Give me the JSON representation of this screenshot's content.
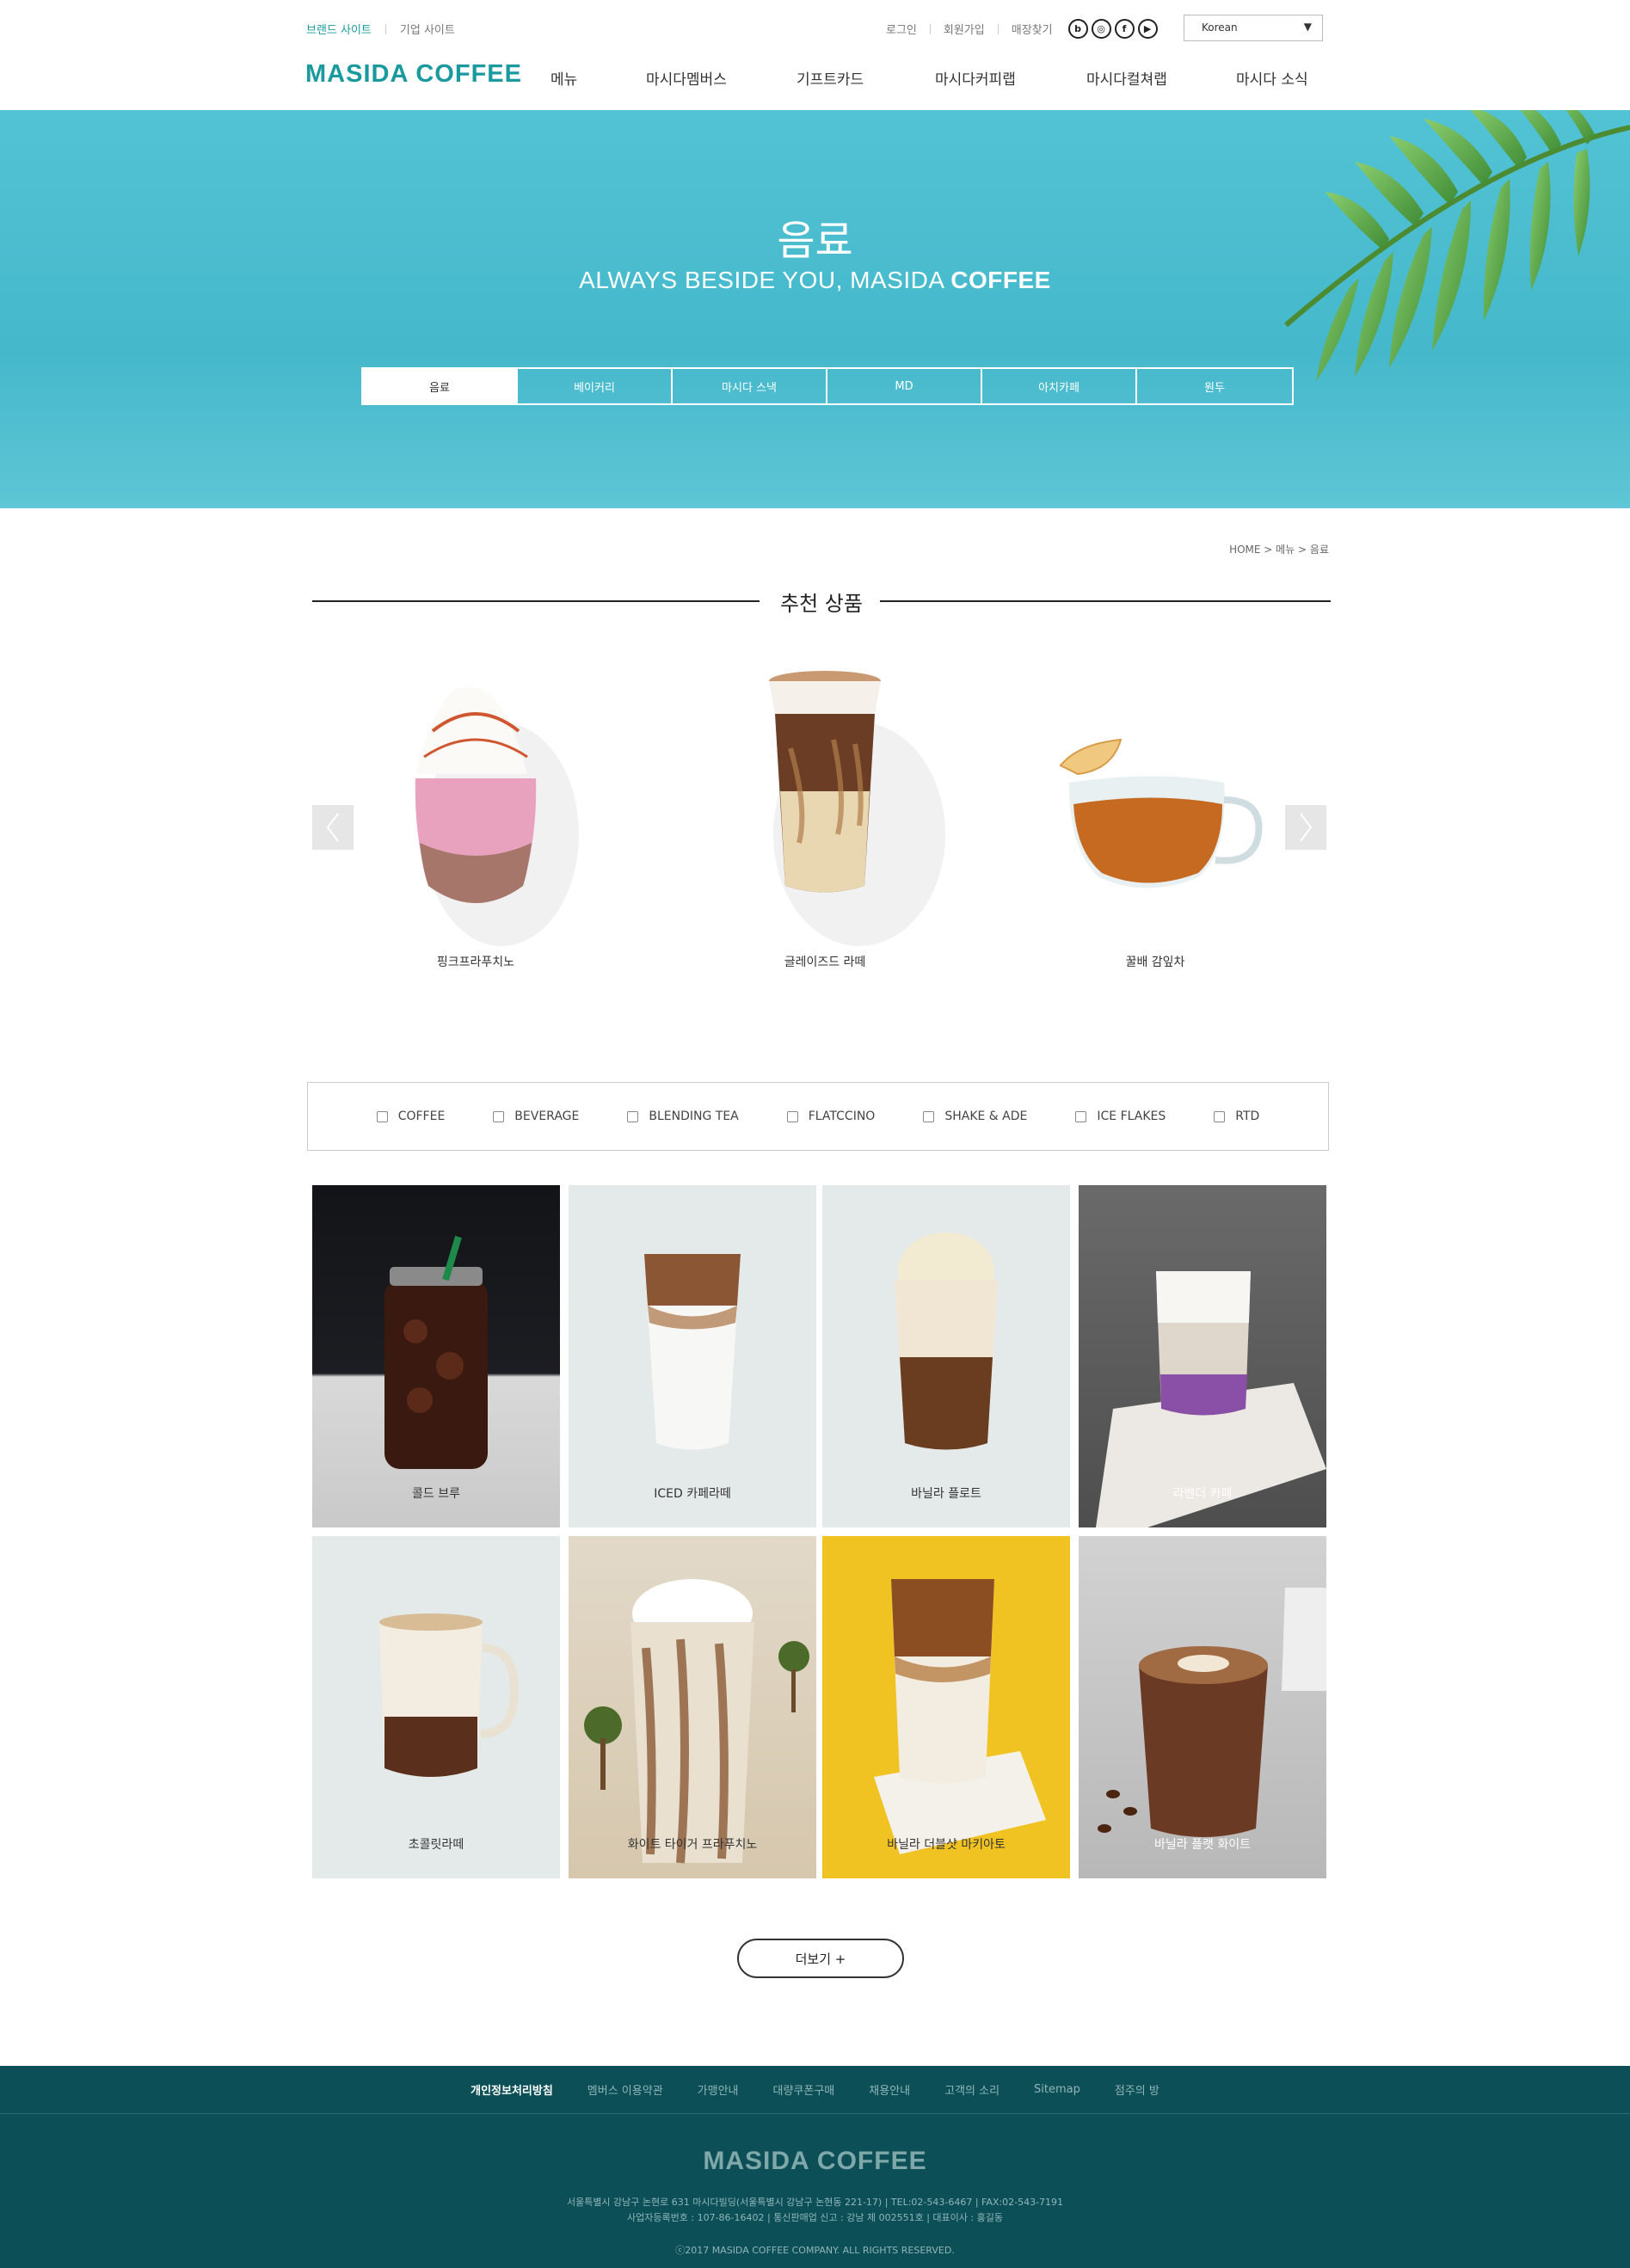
{
  "util": {
    "brand_site": "브랜드 사이트",
    "corp_site": "기업 사이트",
    "login": "로그인",
    "join": "회원가입",
    "store": "매장찾기",
    "language": "Korean"
  },
  "logo": "MASIDA COFFEE",
  "gnb": [
    "메뉴",
    "마시다멤버스",
    "기프트카드",
    "마시다커피랩",
    "마시다컬쳐랩",
    "마시다 소식"
  ],
  "hero": {
    "title": "음료",
    "sub_plain": "ALWAYS BESIDE YOU, MASIDA ",
    "sub_bold": "COFFEE",
    "tabs": [
      "음료",
      "베이커리",
      "마시다 스낵",
      "MD",
      "아치카페",
      "원두"
    ]
  },
  "breadcrumb": "HOME  >  메뉴  >  음료",
  "recommend": {
    "title": "추천 상품",
    "items": [
      "핑크프라푸치노",
      "글레이즈드 라떼",
      "꿀배 감잎차"
    ]
  },
  "filters": [
    "COFFEE",
    "BEVERAGE",
    "BLENDING TEA",
    "FLATCCINO",
    "SHAKE & ADE",
    "ICE FLAKES",
    "RTD"
  ],
  "products": [
    "콜드 브루",
    "ICED 카페라떼",
    "바닐라 플로트",
    "라벤더 카페",
    "초콜릿라떼",
    "화이트 타이거 프라푸치노",
    "바닐라 더블샷 마키아토",
    "바닐라 플랫 화이트"
  ],
  "more_label": "더보기  +",
  "footer": {
    "links": [
      "개인정보처리방침",
      "멤버스 이용약관",
      "가맹안내",
      "대량쿠폰구매",
      "채용안내",
      "고객의 소리",
      "Sitemap",
      "점주의 방"
    ],
    "logo": "MASIDA COFFEE",
    "address": "서울특별시 강남구 논현로 631 마시다빌딩(서울특별시 강남구 논현동 221-17)   |   TEL:02-543-6467   |   FAX:02-543-7191",
    "business": "사업자등록번호 : 107-86-16402   |   통신판매업 신고 : 강남 제 002551호   |   대표이사 : 홍길동",
    "copyright": "ⓒ2017  MASIDA COFFEE COMPANY. ALL RIGHTS RESERVED."
  }
}
